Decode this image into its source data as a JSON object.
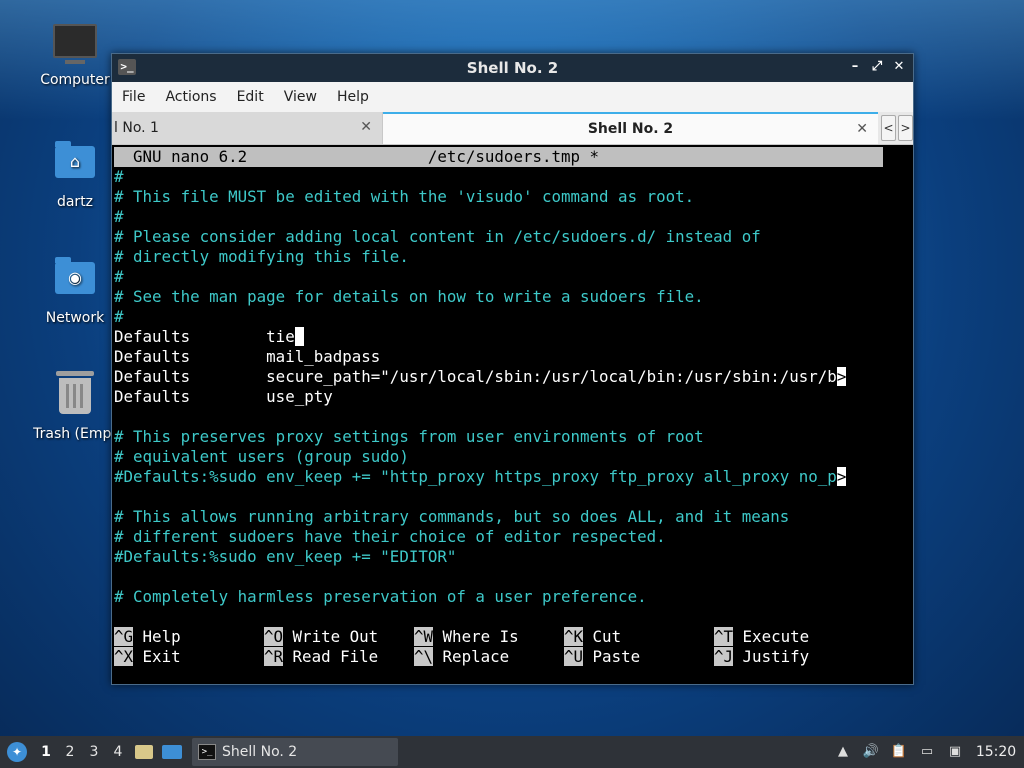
{
  "desktop": {
    "icons": [
      {
        "label": "Computer",
        "icon": "computer-icon"
      },
      {
        "label": "dartz",
        "icon": "home-folder-icon"
      },
      {
        "label": "Network",
        "icon": "network-folder-icon"
      },
      {
        "label": "Trash (Empt",
        "icon": "trash-icon"
      }
    ]
  },
  "window": {
    "title": "Shell No. 2",
    "menu": [
      "File",
      "Actions",
      "Edit",
      "View",
      "Help"
    ],
    "tabs": [
      {
        "label": "l No. 1",
        "active": false
      },
      {
        "label": "Shell No. 2",
        "active": true
      }
    ],
    "tab_scroll_left": "<",
    "tab_scroll_right": ">"
  },
  "nano": {
    "header": "  GNU nano 6.2                   /etc/sudoers.tmp *",
    "lines": [
      {
        "text": "#",
        "type": "comment"
      },
      {
        "text": "# This file MUST be edited with the 'visudo' command as root.",
        "type": "comment"
      },
      {
        "text": "#",
        "type": "comment"
      },
      {
        "text": "# Please consider adding local content in /etc/sudoers.d/ instead of",
        "type": "comment"
      },
      {
        "text": "# directly modifying this file.",
        "type": "comment"
      },
      {
        "text": "#",
        "type": "comment"
      },
      {
        "text": "# See the man page for details on how to write a sudoers file.",
        "type": "comment"
      },
      {
        "text": "#",
        "type": "comment"
      },
      {
        "text": "Defaults        tie",
        "type": "code"
      },
      {
        "text": "Defaults        mail_badpass",
        "type": "code"
      },
      {
        "text": "Defaults        secure_path=\"/usr/local/sbin:/usr/local/bin:/usr/sbin:/usr/b",
        "type": "code"
      },
      {
        "text": "Defaults        use_pty",
        "type": "code"
      },
      {
        "text": "",
        "type": "code"
      },
      {
        "text": "# This preserves proxy settings from user environments of root",
        "type": "comment"
      },
      {
        "text": "# equivalent users (group sudo)",
        "type": "comment"
      },
      {
        "text": "#Defaults:%sudo env_keep += \"http_proxy https_proxy ftp_proxy all_proxy no_p",
        "type": "comment"
      },
      {
        "text": "",
        "type": "code"
      },
      {
        "text": "# This allows running arbitrary commands, but so does ALL, and it means",
        "type": "comment"
      },
      {
        "text": "# different sudoers have their choice of editor respected.",
        "type": "comment"
      },
      {
        "text": "#Defaults:%sudo env_keep += \"EDITOR\"",
        "type": "comment"
      },
      {
        "text": "",
        "type": "code"
      },
      {
        "text": "# Completely harmless preservation of a user preference.",
        "type": "comment"
      }
    ],
    "more_marker": ">",
    "shortcuts_row1": [
      {
        "key": "^G",
        "label": "Help"
      },
      {
        "key": "^O",
        "label": "Write Out"
      },
      {
        "key": "^W",
        "label": "Where Is"
      },
      {
        "key": "^K",
        "label": "Cut"
      },
      {
        "key": "^T",
        "label": "Execute"
      }
    ],
    "shortcuts_row2": [
      {
        "key": "^X",
        "label": "Exit"
      },
      {
        "key": "^R",
        "label": "Read File"
      },
      {
        "key": "^\\",
        "label": "Replace"
      },
      {
        "key": "^U",
        "label": "Paste"
      },
      {
        "key": "^J",
        "label": "Justify"
      }
    ]
  },
  "taskbar": {
    "workspaces": [
      "1",
      "2",
      "3",
      "4"
    ],
    "task_label": "Shell No. 2",
    "clock": "15:20"
  },
  "colors": {
    "comment": "#3ec9c9",
    "titlebar": "#1c2c3c",
    "accent": "#3daee9"
  }
}
